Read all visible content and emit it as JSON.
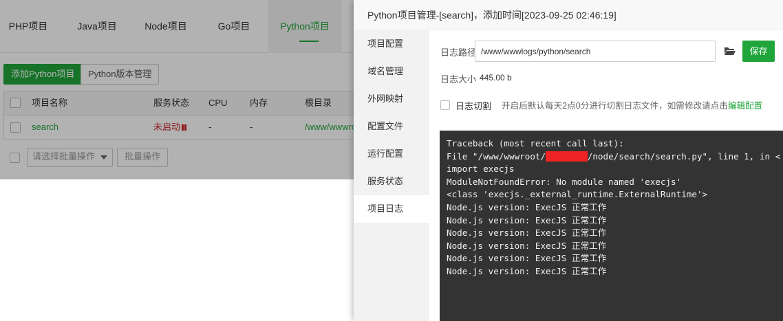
{
  "tabs": [
    {
      "label": "PHP项目"
    },
    {
      "label": "Java项目"
    },
    {
      "label": "Node项目"
    },
    {
      "label": "Go项目"
    },
    {
      "label": "Python项目",
      "active": true
    }
  ],
  "toolbar": {
    "add_label": "添加Python项目",
    "version_label": "Python版本管理"
  },
  "table": {
    "headers": [
      "项目名称",
      "服务状态",
      "CPU",
      "内存",
      "根目录"
    ],
    "rows": [
      {
        "name": "search",
        "status": "未启动",
        "cpu": "-",
        "memory": "-",
        "root": "/www/wwwroot"
      }
    ]
  },
  "batch": {
    "select_placeholder": "请选择批量操作",
    "button_label": "批量操作"
  },
  "dialog": {
    "title": "Python项目管理-[search]，添加时间[2023-09-25 02:46:19]",
    "sidebar": [
      {
        "label": "项目配置"
      },
      {
        "label": "域名管理"
      },
      {
        "label": "外网映射"
      },
      {
        "label": "配置文件"
      },
      {
        "label": "运行配置"
      },
      {
        "label": "服务状态"
      },
      {
        "label": "项目日志",
        "active": true
      }
    ],
    "log": {
      "path_label": "日志路径",
      "path_value": "/www/wwwlogs/python/search",
      "save_label": "保存",
      "size_label": "日志大小",
      "size_value": "445.00 b",
      "cut_label": "日志切割",
      "cut_hint": "开启后默认每天2点0分进行切割日志文件，如需修改请点击",
      "cut_link": "编辑配置"
    },
    "terminal": {
      "lines": [
        {
          "text": "Traceback (most recent call last):"
        },
        {
          "pre": "File \"/www/wwwroot/",
          "redacted": "xxxxxxxx",
          "post": "/node/search/search.py\", line 1, in <"
        },
        {
          "text": "import execjs"
        },
        {
          "text": "ModuleNotFoundError: No module named 'execjs'"
        },
        {
          "text": "<class 'execjs._external_runtime.ExternalRuntime'>"
        },
        {
          "text": "Node.js version: ExecJS 正常工作"
        },
        {
          "text": "Node.js version: ExecJS 正常工作"
        },
        {
          "text": "Node.js version: ExecJS 正常工作"
        },
        {
          "text": "Node.js version: ExecJS 正常工作"
        },
        {
          "text": "Node.js version: ExecJS 正常工作"
        },
        {
          "text": "Node.js version: ExecJS 正常工作"
        }
      ]
    }
  },
  "colors": {
    "accent": "#20a53a",
    "danger": "#cc2222",
    "terminal_bg": "#333333"
  }
}
